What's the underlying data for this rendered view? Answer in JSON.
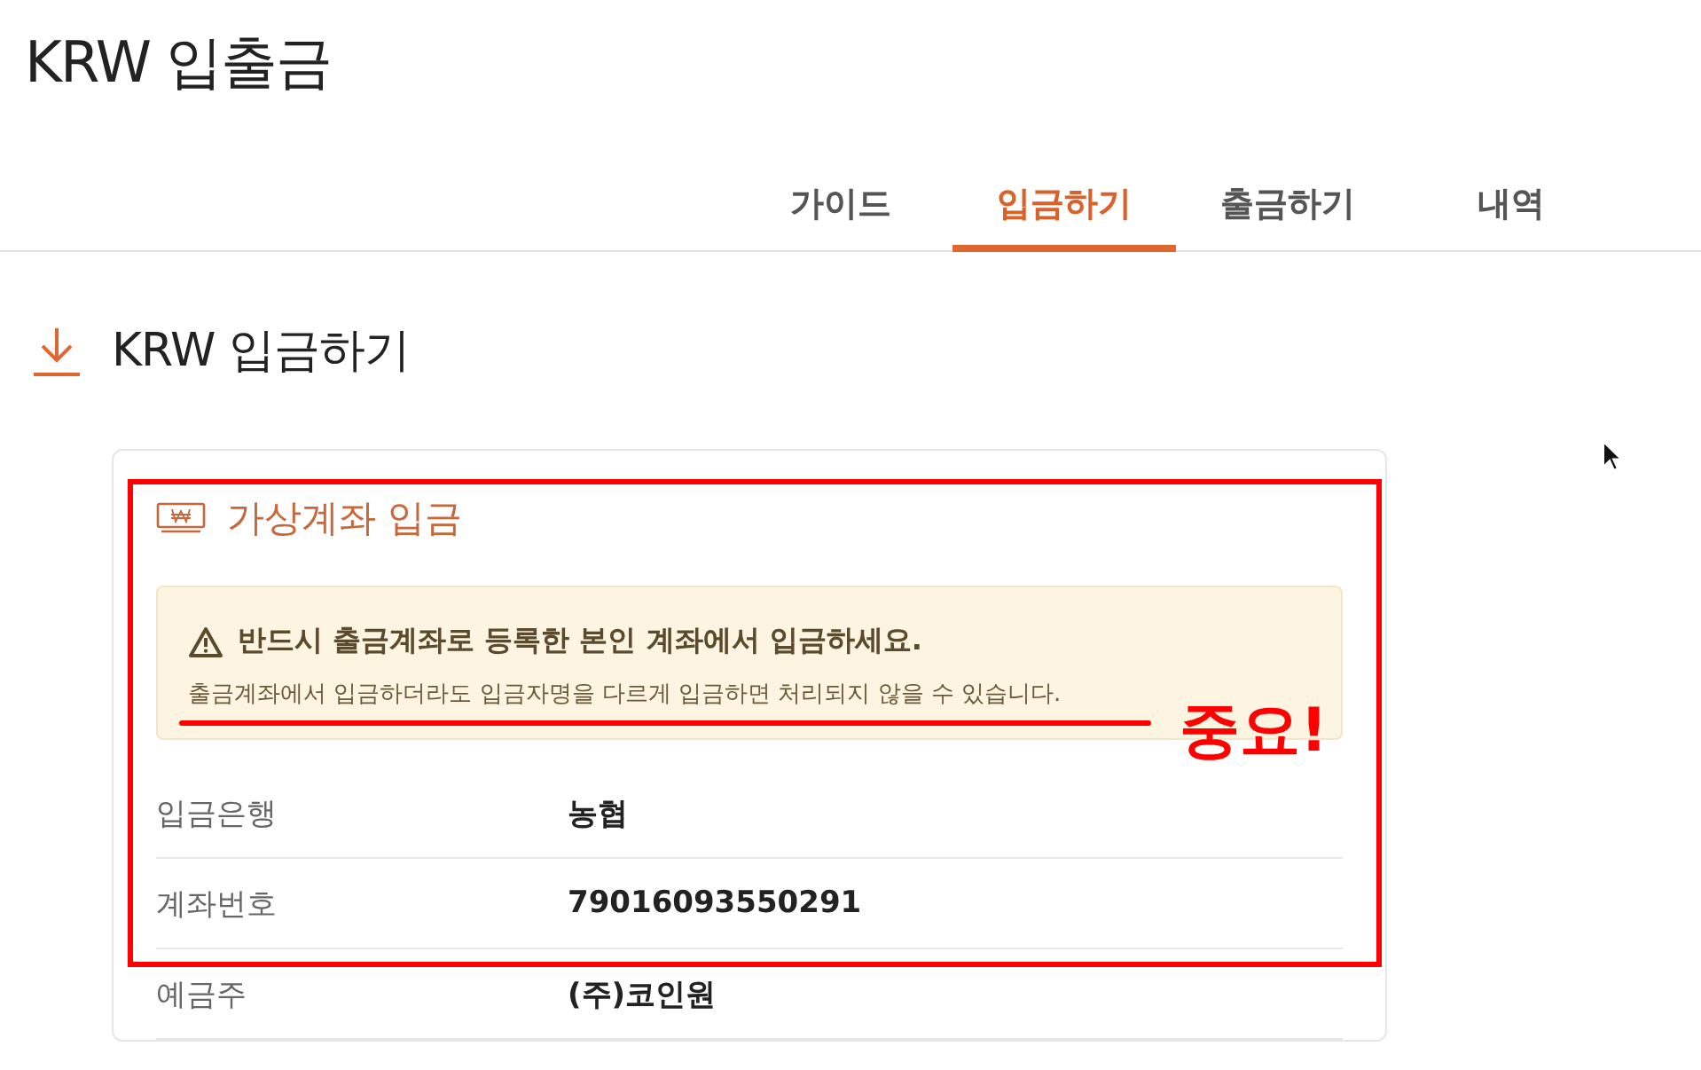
{
  "page_title": "KRW 입출금",
  "tabs": [
    {
      "label": "가이드",
      "selected": false
    },
    {
      "label": "입금하기",
      "selected": true
    },
    {
      "label": "출금하기",
      "selected": false
    },
    {
      "label": "내역",
      "selected": false
    }
  ],
  "section_title": "KRW 입금하기",
  "card": {
    "title": "가상계좌 입금",
    "notice": {
      "heading": "반드시 출금계좌로 등록한 본인 계좌에서 입금하세요.",
      "body": "출금계좌에서 입금하더라도 입금자명을 다르게 입금하면 처리되지 않을 수 있습니다."
    },
    "rows": [
      {
        "label": "입금은행",
        "value": "농협"
      },
      {
        "label": "계좌번호",
        "value": "79016093550291"
      },
      {
        "label": "예금주",
        "value": "(주)코인원"
      }
    ]
  },
  "annotation": {
    "text": "중요!"
  }
}
